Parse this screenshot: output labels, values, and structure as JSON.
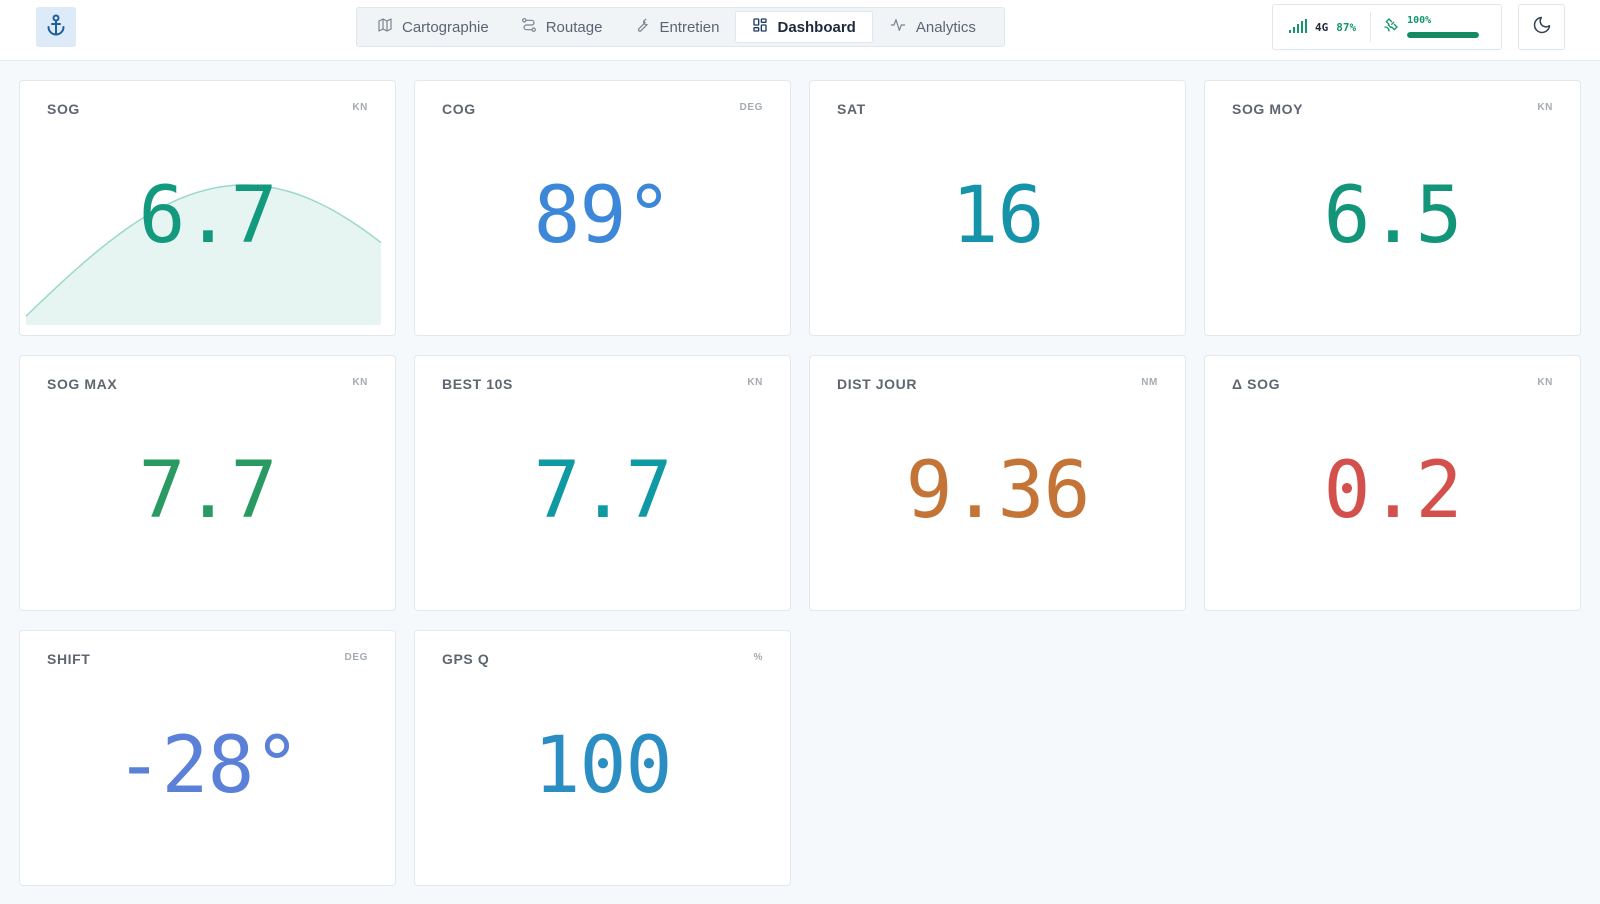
{
  "header": {
    "logo_icon": "anchor-icon",
    "tabs": [
      {
        "label": "Cartographie",
        "icon": "map-icon",
        "active": false
      },
      {
        "label": "Routage",
        "icon": "route-icon",
        "active": false
      },
      {
        "label": "Entretien",
        "icon": "wrench-icon",
        "active": false
      },
      {
        "label": "Dashboard",
        "icon": "grid-icon",
        "active": true
      },
      {
        "label": "Analytics",
        "icon": "activity-icon",
        "active": false
      }
    ],
    "network": {
      "type": "4G",
      "signal": "87%"
    },
    "gps_quality": {
      "label": "100%",
      "fraction": 1.0
    },
    "theme_icon": "moon-icon"
  },
  "cards": [
    {
      "label": "SOG",
      "unit": "KN",
      "value": "6.7",
      "color": "#139a7e",
      "sparkline": true
    },
    {
      "label": "COG",
      "unit": "DEG",
      "value": "89°",
      "color": "#3c87d8"
    },
    {
      "label": "SAT",
      "unit": "",
      "value": "16",
      "color": "#1593a8"
    },
    {
      "label": "SOG MOY",
      "unit": "KN",
      "value": "6.5",
      "color": "#13957a"
    },
    {
      "label": "SOG MAX",
      "unit": "KN",
      "value": "7.7",
      "color": "#289a62"
    },
    {
      "label": "BEST 10S",
      "unit": "KN",
      "value": "7.7",
      "color": "#0f9aa3"
    },
    {
      "label": "DIST JOUR",
      "unit": "NM",
      "value": "9.36",
      "color": "#c57437"
    },
    {
      "label": "Δ SOG",
      "unit": "KN",
      "value": "0.2",
      "color": "#d4504c"
    },
    {
      "label": "SHIFT",
      "unit": "DEG",
      "value": "-28°",
      "color": "#5a80d8"
    },
    {
      "label": "GPS Q",
      "unit": "%",
      "value": "100",
      "color": "#2a8ec3"
    }
  ],
  "colors": {
    "accent": "#139a7e",
    "sparkline_fill": "#e7f5f2",
    "sparkline_stroke": "#9bd8cb"
  }
}
